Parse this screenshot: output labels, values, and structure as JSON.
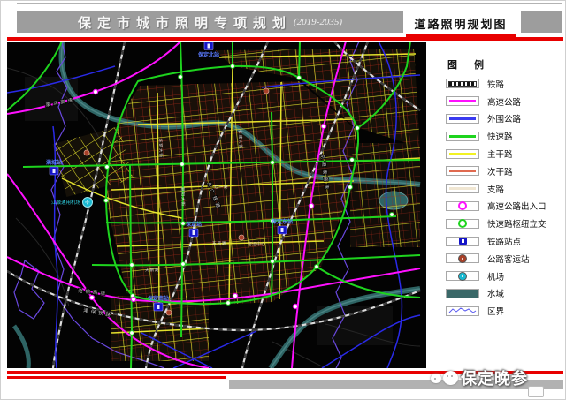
{
  "header": {
    "title": "保定市城市照明专项规划",
    "subtitle": "(2019-2035)",
    "page_label": "道路照明规划图"
  },
  "legend": {
    "title": "图 例",
    "items": [
      {
        "label": "铁路",
        "type": "railway",
        "color": "#151515"
      },
      {
        "label": "高速公路",
        "type": "line",
        "color": "#ff10ff"
      },
      {
        "label": "外围公路",
        "type": "line",
        "color": "#3a3af0"
      },
      {
        "label": "快速路",
        "type": "line",
        "color": "#1ed41e"
      },
      {
        "label": "主干路",
        "type": "line",
        "color": "#f2f222"
      },
      {
        "label": "次干路",
        "type": "line",
        "color": "#e06a50"
      },
      {
        "label": "支路",
        "type": "line",
        "color": "#f0e6d2"
      },
      {
        "label": "高速公路出入口",
        "type": "circle",
        "color": "#ff10ff"
      },
      {
        "label": "快速路枢纽立交",
        "type": "circle",
        "color": "#1ed41e"
      },
      {
        "label": "铁路站点",
        "type": "station",
        "color": "#1515c8"
      },
      {
        "label": "公路客运站",
        "type": "dot",
        "color": "#a84028"
      },
      {
        "label": "机场",
        "type": "dot",
        "color": "#18b8d0"
      },
      {
        "label": "水域",
        "type": "fill",
        "color": "#3a6868"
      },
      {
        "label": "区界",
        "type": "boundary",
        "color": "#5a5af0"
      }
    ]
  },
  "map": {
    "stations": [
      {
        "name": "保定北站"
      },
      {
        "name": "保定站"
      },
      {
        "name": "保定东站"
      },
      {
        "name": "保定南站"
      },
      {
        "name": "满城站"
      }
    ],
    "airport_label": "江城通用机场",
    "bus_station_label": "客运中心",
    "corridors": [
      {
        "name": "荣乌高速"
      },
      {
        "name": "沧榆高速"
      },
      {
        "name": "京港澳高速"
      },
      {
        "name": "京广铁路"
      },
      {
        "name": "津保铁路"
      }
    ],
    "roads": [
      "七一路",
      "东风路",
      "天鹅路",
      "乐凯大街",
      "朝阳大街",
      "长城大街"
    ]
  },
  "watermark": "保定晚参",
  "colors": {
    "accent_red": "#e80000",
    "header_gray": "#9d9d9d",
    "footer_gray": "#b2b2b2",
    "map_background": "#030303",
    "water": "#2e6464"
  }
}
